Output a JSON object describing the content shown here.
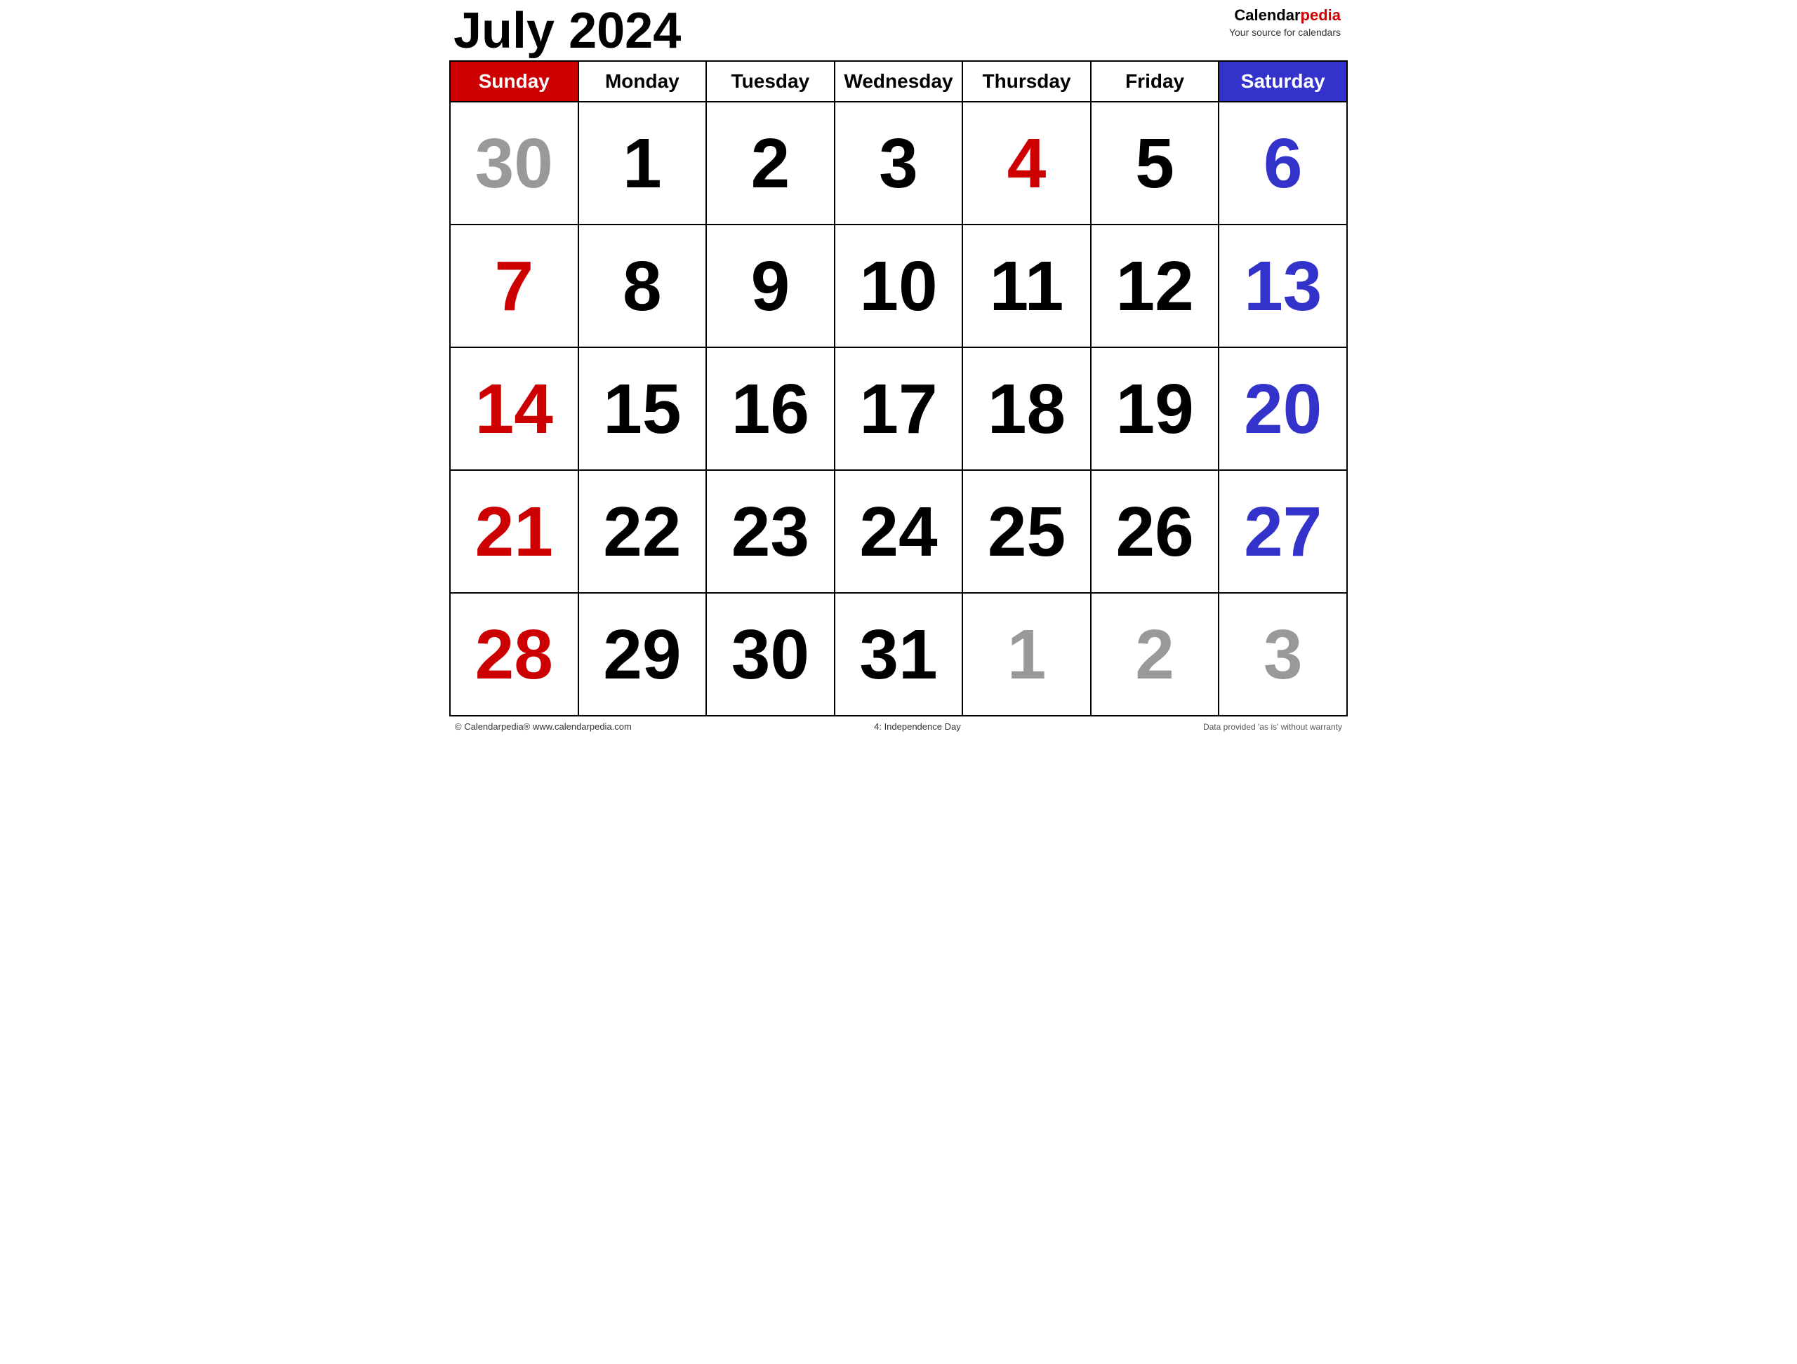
{
  "header": {
    "title": "July 2024",
    "brand": {
      "name_before_red": "Calendar",
      "name_red": "pedia",
      "tagline": "Your source for calendars"
    }
  },
  "days_of_week": [
    {
      "label": "Sunday",
      "type": "sunday"
    },
    {
      "label": "Monday",
      "type": "weekday"
    },
    {
      "label": "Tuesday",
      "type": "weekday"
    },
    {
      "label": "Wednesday",
      "type": "weekday"
    },
    {
      "label": "Thursday",
      "type": "weekday"
    },
    {
      "label": "Friday",
      "type": "weekday"
    },
    {
      "label": "Saturday",
      "type": "saturday"
    }
  ],
  "weeks": [
    [
      {
        "number": "30",
        "color": "gray",
        "current_month": false
      },
      {
        "number": "1",
        "color": "black",
        "current_month": true
      },
      {
        "number": "2",
        "color": "black",
        "current_month": true
      },
      {
        "number": "3",
        "color": "black",
        "current_month": true
      },
      {
        "number": "4",
        "color": "red",
        "current_month": true,
        "holiday": "Independence Day"
      },
      {
        "number": "5",
        "color": "black",
        "current_month": true
      },
      {
        "number": "6",
        "color": "blue",
        "current_month": true
      }
    ],
    [
      {
        "number": "7",
        "color": "red",
        "current_month": true
      },
      {
        "number": "8",
        "color": "black",
        "current_month": true
      },
      {
        "number": "9",
        "color": "black",
        "current_month": true
      },
      {
        "number": "10",
        "color": "black",
        "current_month": true
      },
      {
        "number": "11",
        "color": "black",
        "current_month": true
      },
      {
        "number": "12",
        "color": "black",
        "current_month": true
      },
      {
        "number": "13",
        "color": "blue",
        "current_month": true
      }
    ],
    [
      {
        "number": "14",
        "color": "red",
        "current_month": true
      },
      {
        "number": "15",
        "color": "black",
        "current_month": true
      },
      {
        "number": "16",
        "color": "black",
        "current_month": true
      },
      {
        "number": "17",
        "color": "black",
        "current_month": true
      },
      {
        "number": "18",
        "color": "black",
        "current_month": true
      },
      {
        "number": "19",
        "color": "black",
        "current_month": true
      },
      {
        "number": "20",
        "color": "blue",
        "current_month": true
      }
    ],
    [
      {
        "number": "21",
        "color": "red",
        "current_month": true
      },
      {
        "number": "22",
        "color": "black",
        "current_month": true
      },
      {
        "number": "23",
        "color": "black",
        "current_month": true
      },
      {
        "number": "24",
        "color": "black",
        "current_month": true
      },
      {
        "number": "25",
        "color": "black",
        "current_month": true
      },
      {
        "number": "26",
        "color": "black",
        "current_month": true
      },
      {
        "number": "27",
        "color": "blue",
        "current_month": true
      }
    ],
    [
      {
        "number": "28",
        "color": "red",
        "current_month": true
      },
      {
        "number": "29",
        "color": "black",
        "current_month": true
      },
      {
        "number": "30",
        "color": "black",
        "current_month": true
      },
      {
        "number": "31",
        "color": "black",
        "current_month": true
      },
      {
        "number": "1",
        "color": "gray",
        "current_month": false
      },
      {
        "number": "2",
        "color": "gray",
        "current_month": false
      },
      {
        "number": "3",
        "color": "gray",
        "current_month": false
      }
    ]
  ],
  "footer": {
    "copyright": "© Calendarpedia®   www.calendarpedia.com",
    "holiday_note": "4: Independence Day",
    "disclaimer": "Data provided 'as is' without warranty"
  }
}
